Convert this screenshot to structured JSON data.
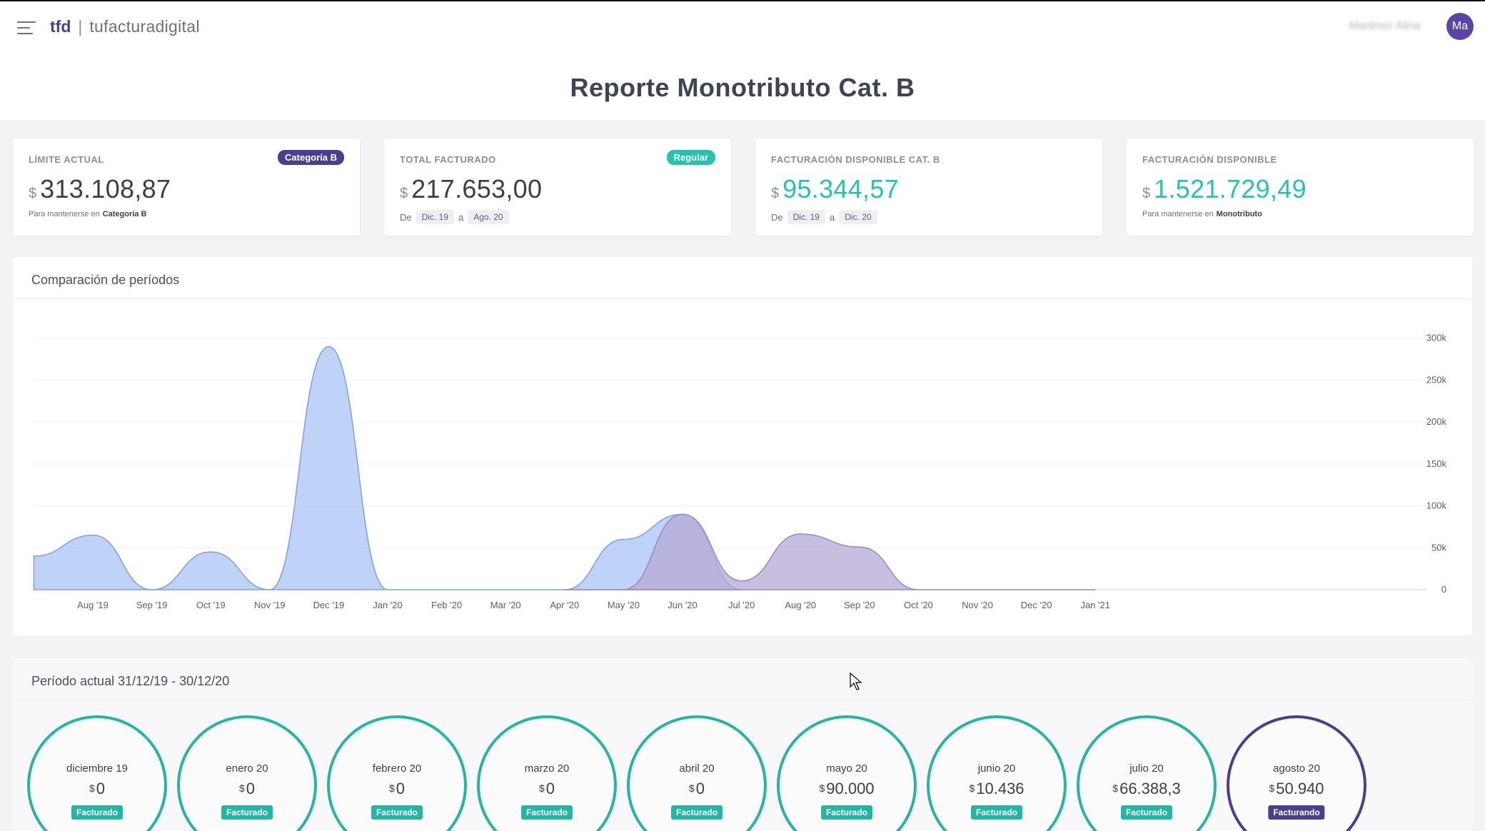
{
  "header": {
    "brand_short": "tfd",
    "brand_separator": "|",
    "brand_name": "tufacturadigital",
    "user_name": "Martinez Alina",
    "avatar_initials": "Ma"
  },
  "page_title": "Reporte Monotributo Cat. B",
  "cards": [
    {
      "label": "LÍMITE ACTUAL",
      "badge": "Categoría B",
      "badge_color": "#4a3f8f",
      "currency": "$",
      "value": "313.108,87",
      "accent": false,
      "note_prefix": "Para mantenerse en",
      "note_strong": "Categoría B"
    },
    {
      "label": "TOTAL FACTURADO",
      "badge": "Regular",
      "badge_color": "#25c2ad",
      "currency": "$",
      "value": "217.653,00",
      "accent": false,
      "range_de": "De",
      "range_from": "Dic. 19",
      "range_a": "a",
      "range_to": "Ago. 20"
    },
    {
      "label": "FACTURACIÓN DISPONIBLE CAT. B",
      "currency": "$",
      "value": "95.344,57",
      "accent": true,
      "range_de": "De",
      "range_from": "Dic. 19",
      "range_a": "a",
      "range_to": "Dic. 20"
    },
    {
      "label": "FACTURACIÓN DISPONIBLE",
      "currency": "$",
      "value": "1.521.729,49",
      "accent": true,
      "note_prefix": "Para mantenerse en",
      "note_strong": "Monotributo"
    }
  ],
  "chart_panel_title": "Comparación de períodos",
  "chart_data": {
    "type": "area",
    "x_labels": [
      "Aug '19",
      "Sep '19",
      "Oct '19",
      "Nov '19",
      "Dec '19",
      "Jan '20",
      "Feb '20",
      "Mar '20",
      "Apr '20",
      "May '20",
      "Jun '20",
      "Jul '20",
      "Aug '20",
      "Sep '20",
      "Oct '20",
      "Nov '20",
      "Dec '20",
      "Jan '21"
    ],
    "y_ticks": [
      "0",
      "50k",
      "100k",
      "150k",
      "200k",
      "250k",
      "300k"
    ],
    "ylim": [
      0,
      350000
    ],
    "grid": true,
    "series": [
      {
        "color": "#a9c4f5",
        "points": [
          [
            "Jul '19",
            40000
          ],
          [
            "Aug '19",
            65000
          ],
          [
            "Sep '19",
            0
          ],
          [
            "Oct '19",
            45000
          ],
          [
            "Nov '19",
            0
          ],
          [
            "Dec '19",
            290000
          ],
          [
            "Jan '20",
            0
          ],
          [
            "Apr '20",
            0
          ],
          [
            "May '20",
            60000
          ],
          [
            "Jun '20",
            90000
          ],
          [
            "Jul '20",
            0
          ]
        ]
      },
      {
        "color": "#b5aad6",
        "points": [
          [
            "Apr '20",
            0
          ],
          [
            "May '20",
            0
          ],
          [
            "Jun '20",
            90000
          ],
          [
            "Jul '20",
            10436
          ],
          [
            "Aug '20",
            66388
          ],
          [
            "Sep '20",
            50940
          ],
          [
            "Oct '20",
            0
          ],
          [
            "Jan '21",
            0
          ]
        ]
      }
    ]
  },
  "period_title": "Período actual 31/12/19 - 30/12/20",
  "months": [
    {
      "name": "diciembre 19",
      "currency": "$",
      "value": "0",
      "status": "Facturado"
    },
    {
      "name": "enero 20",
      "currency": "$",
      "value": "0",
      "status": "Facturado"
    },
    {
      "name": "febrero 20",
      "currency": "$",
      "value": "0",
      "status": "Facturado"
    },
    {
      "name": "marzo 20",
      "currency": "$",
      "value": "0",
      "status": "Facturado"
    },
    {
      "name": "abril 20",
      "currency": "$",
      "value": "0",
      "status": "Facturado"
    },
    {
      "name": "mayo 20",
      "currency": "$",
      "value": "90.000",
      "status": "Facturado"
    },
    {
      "name": "junio 20",
      "currency": "$",
      "value": "10.436",
      "status": "Facturado"
    },
    {
      "name": "julio 20",
      "currency": "$",
      "value": "66.388,3",
      "status": "Facturado"
    },
    {
      "name": "agosto 20",
      "currency": "$",
      "value": "50.940",
      "status": "Facturando"
    }
  ]
}
